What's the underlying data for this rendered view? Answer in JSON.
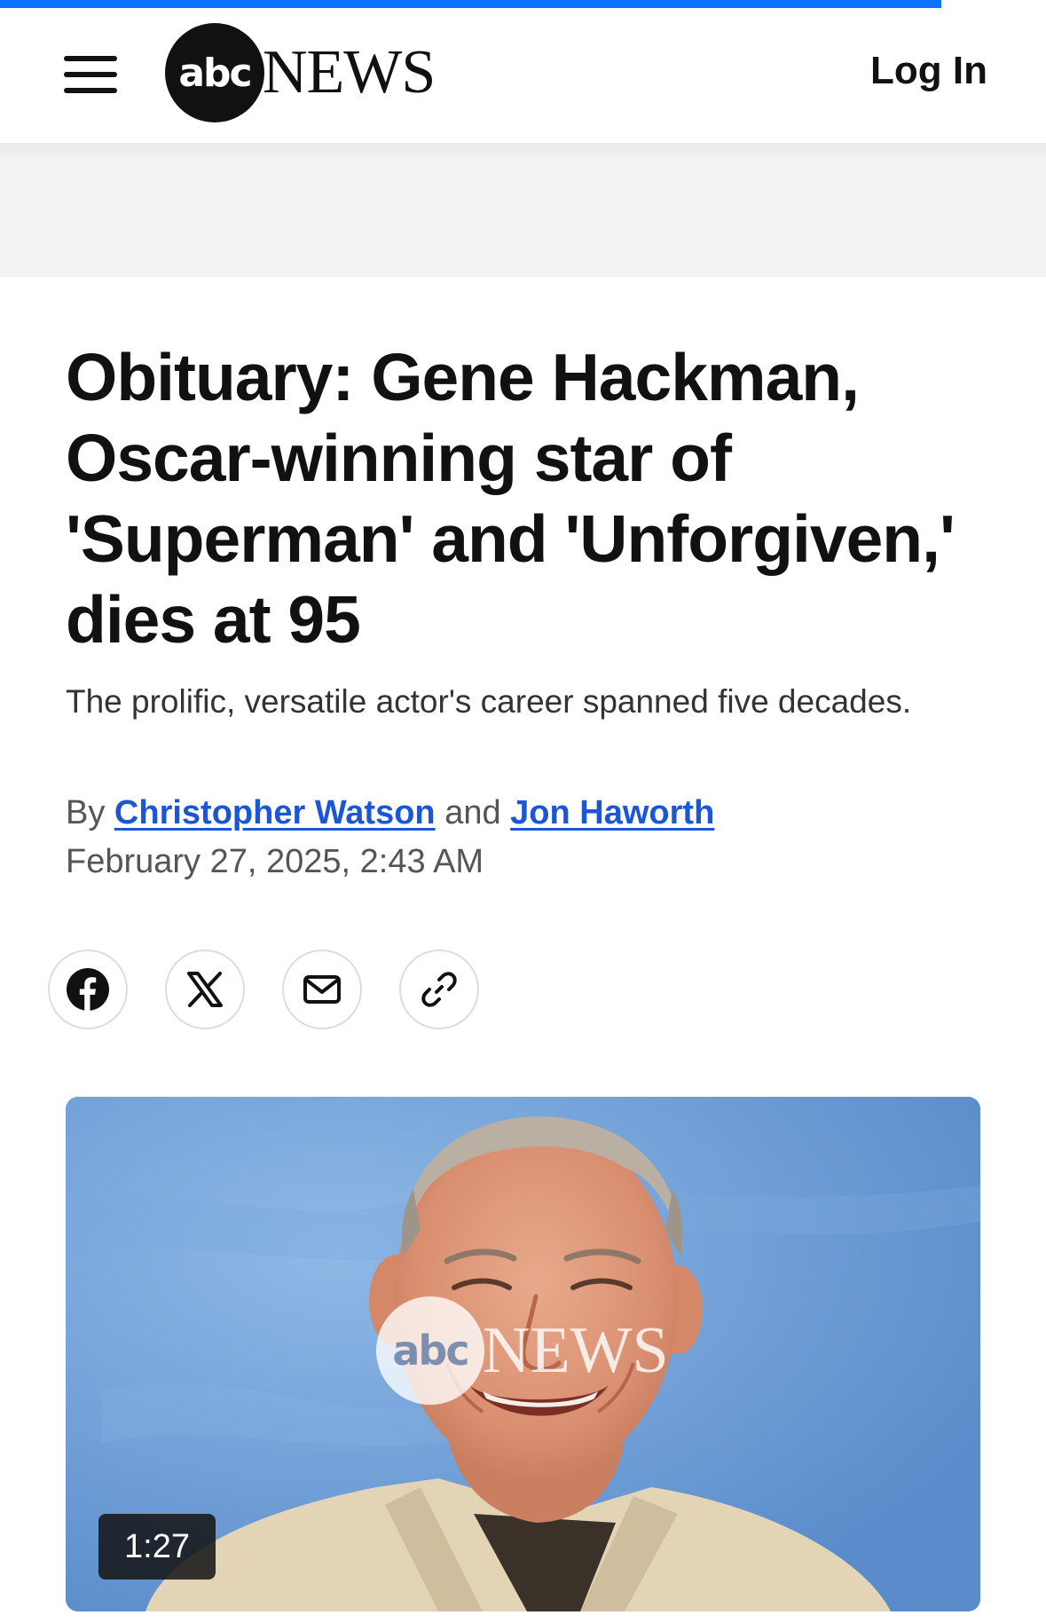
{
  "progress": {
    "fraction": 0.9,
    "color": "#0a74ff"
  },
  "header": {
    "logo": {
      "mark": "abc",
      "wordmark": "NEWS"
    },
    "login_label": "Log In",
    "menu_icon": "hamburger-menu-icon"
  },
  "article": {
    "headline": "Obituary: Gene Hackman, Oscar-winning star of 'Superman' and 'Unforgiven,' dies at 95",
    "subhead": "The prolific, versatile actor's career spanned five decades.",
    "byline": {
      "prefix": "By",
      "author1": "Christopher Watson",
      "conjunction": "and",
      "author2": "Jon Haworth"
    },
    "date": "February 27, 2025, 2:43 AM"
  },
  "share": {
    "icons": [
      "facebook-icon",
      "x-icon",
      "email-icon",
      "link-icon"
    ]
  },
  "video": {
    "duration": "1:27",
    "watermark": {
      "mark": "abc",
      "wordmark": "NEWS"
    }
  },
  "colors": {
    "link": "#1a56d6",
    "text": "#111111",
    "muted": "#555555"
  }
}
